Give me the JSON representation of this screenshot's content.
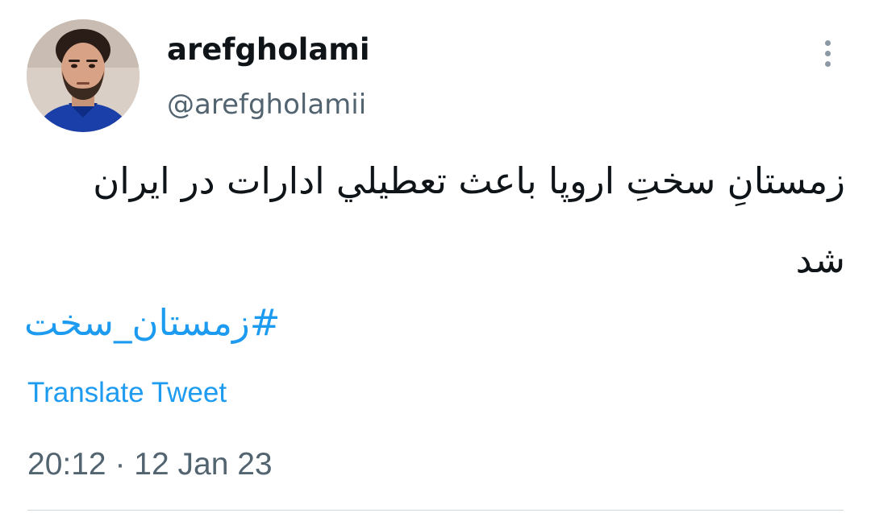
{
  "author": {
    "display_name": "arefgholami",
    "handle": "@arefgholamii",
    "avatar_icon": "profile-photo"
  },
  "tweet": {
    "text": "زمستانِ سختِ اروپا باعث تعطيلي ادارات در ایران شد",
    "hashtag": "#زمستان_سخت",
    "translate_label": "Translate Tweet",
    "time": "20:12",
    "separator": "·",
    "date": "12 Jan 23"
  },
  "more_icon": "more-vertical-icon",
  "colors": {
    "text": "#0f1419",
    "secondary": "#536471",
    "link": "#1d9bf0",
    "divider": "#cfd9de"
  }
}
